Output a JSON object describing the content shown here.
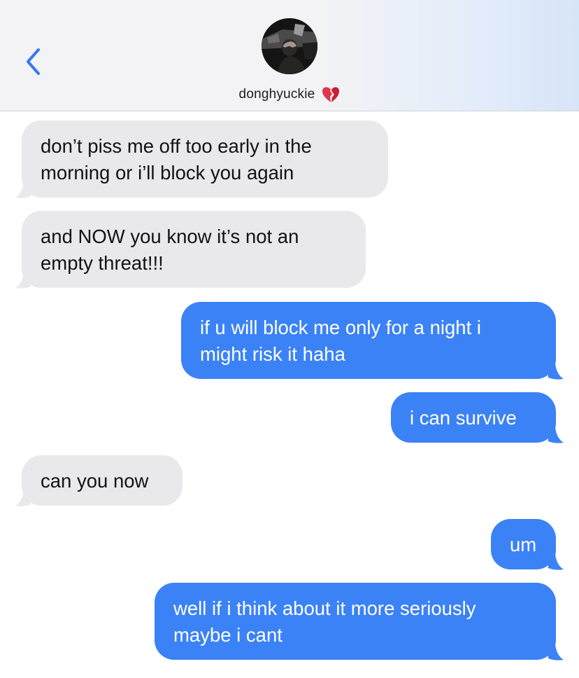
{
  "header": {
    "contact_name": "donghyuckie",
    "back_icon": "chevron-left-icon",
    "status_emoji": "broken-heart-icon",
    "colors": {
      "accent": "#3478f6",
      "incoming_bubble": "#e9e9eb",
      "outgoing_bubble": "#3b82f6"
    }
  },
  "messages": [
    {
      "direction": "incoming",
      "text": "don’t piss me off too early in the\nmorning or i’ll block you again"
    },
    {
      "direction": "incoming",
      "text": "and NOW you know it’s not an\nempty threat!!!"
    },
    {
      "direction": "outgoing",
      "text": "if u will block me only for a night i\nmight risk it haha"
    },
    {
      "direction": "outgoing",
      "text": "i can survive"
    },
    {
      "direction": "incoming",
      "text": "can you now"
    },
    {
      "direction": "outgoing",
      "text": "um"
    },
    {
      "direction": "outgoing",
      "text": "well if i think about it more seriously\nmaybe i cant"
    }
  ]
}
